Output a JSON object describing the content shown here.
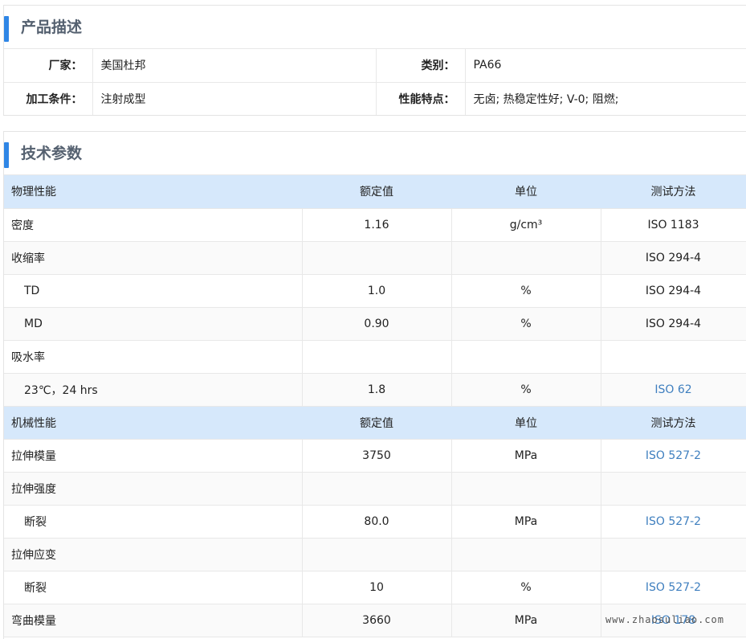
{
  "product": {
    "title": "产品描述",
    "rows": [
      [
        {
          "label": "厂家：",
          "value": "美国杜邦"
        },
        {
          "label": "类别：",
          "value": "PA66"
        }
      ],
      [
        {
          "label": "加工条件：",
          "value": "注射成型"
        },
        {
          "label": "性能特点：",
          "value": "无卤; 热稳定性好; V-0; 阻燃;"
        }
      ]
    ]
  },
  "specs": {
    "title": "技术参数",
    "rows": [
      {
        "type": "header",
        "name": "物理性能",
        "value": "额定值",
        "unit": "单位",
        "method": "测试方法"
      },
      {
        "type": "item",
        "name": "密度",
        "value": "1.16",
        "unit": "g/cm³",
        "method": "ISO 1183",
        "link": false
      },
      {
        "type": "item",
        "name": "收缩率",
        "value": "",
        "unit": "",
        "method": "ISO 294-4",
        "link": false
      },
      {
        "type": "sub",
        "name": "TD",
        "value": "1.0",
        "unit": "%",
        "method": "ISO 294-4",
        "link": false
      },
      {
        "type": "sub",
        "name": "MD",
        "value": "0.90",
        "unit": "%",
        "method": "ISO 294-4",
        "link": false
      },
      {
        "type": "item",
        "name": "吸水率",
        "value": "",
        "unit": "",
        "method": "",
        "link": false
      },
      {
        "type": "sub",
        "name": "23℃，24 hrs",
        "value": "1.8",
        "unit": "%",
        "method": "ISO 62",
        "link": true
      },
      {
        "type": "header",
        "name": "机械性能",
        "value": "额定值",
        "unit": "单位",
        "method": "测试方法"
      },
      {
        "type": "item",
        "name": "拉伸模量",
        "value": "3750",
        "unit": "MPa",
        "method": "ISO 527-2",
        "link": true
      },
      {
        "type": "item",
        "name": "拉伸强度",
        "value": "",
        "unit": "",
        "method": "",
        "link": false
      },
      {
        "type": "sub",
        "name": "断裂",
        "value": "80.0",
        "unit": "MPa",
        "method": "ISO 527-2",
        "link": true
      },
      {
        "type": "item",
        "name": "拉伸应变",
        "value": "",
        "unit": "",
        "method": "",
        "link": false
      },
      {
        "type": "sub",
        "name": "断裂",
        "value": "10",
        "unit": "%",
        "method": "ISO 527-2",
        "link": true
      },
      {
        "type": "item",
        "name": "弯曲模量",
        "value": "3660",
        "unit": "MPa",
        "method": "ISO 178",
        "link": true
      }
    ]
  },
  "watermark": "www.zhaosuliao.com"
}
